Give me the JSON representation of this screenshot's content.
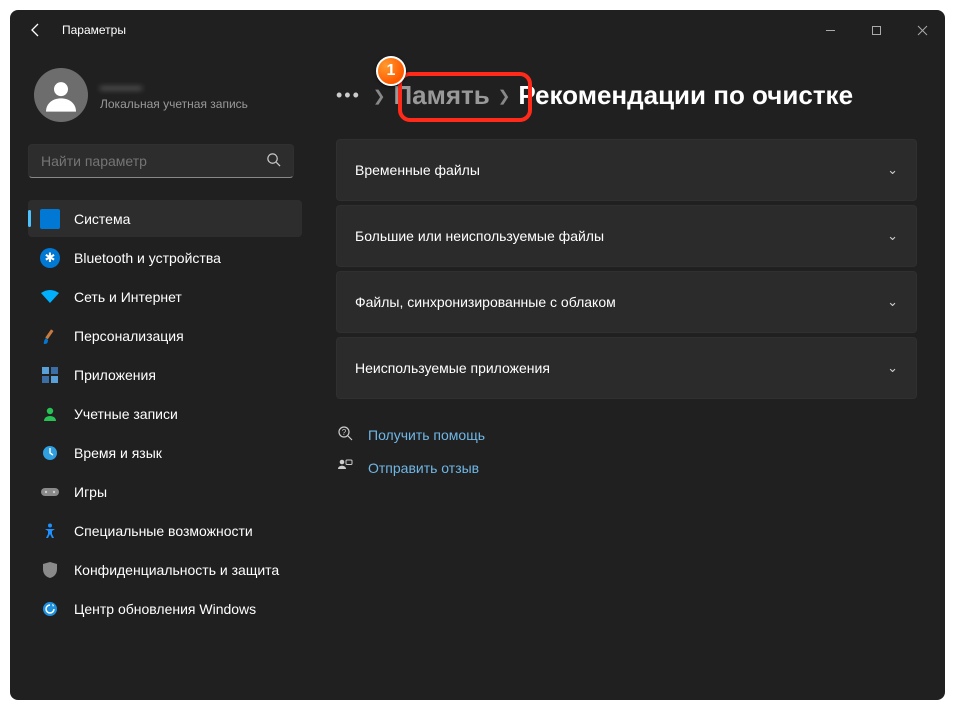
{
  "window": {
    "title": "Параметры"
  },
  "user": {
    "name": "———",
    "subtitle": "Локальная учетная запись"
  },
  "search": {
    "placeholder": "Найти параметр"
  },
  "nav": {
    "items": [
      {
        "label": "Система",
        "selected": true
      },
      {
        "label": "Bluetooth и устройства",
        "selected": false
      },
      {
        "label": "Сеть и Интернет",
        "selected": false
      },
      {
        "label": "Персонализация",
        "selected": false
      },
      {
        "label": "Приложения",
        "selected": false
      },
      {
        "label": "Учетные записи",
        "selected": false
      },
      {
        "label": "Время и язык",
        "selected": false
      },
      {
        "label": "Игры",
        "selected": false
      },
      {
        "label": "Специальные возможности",
        "selected": false
      },
      {
        "label": "Конфиденциальность и защита",
        "selected": false
      },
      {
        "label": "Центр обновления Windows",
        "selected": false
      }
    ]
  },
  "breadcrumb": {
    "parent": "Память",
    "current": "Рекомендации по очистке"
  },
  "sections": [
    {
      "label": "Временные файлы"
    },
    {
      "label": "Большие или неиспользуемые файлы"
    },
    {
      "label": "Файлы, синхронизированные с облаком"
    },
    {
      "label": "Неиспользуемые приложения"
    }
  ],
  "links": {
    "help": "Получить помощь",
    "feedback": "Отправить отзыв"
  },
  "annotation": {
    "step": "1"
  }
}
